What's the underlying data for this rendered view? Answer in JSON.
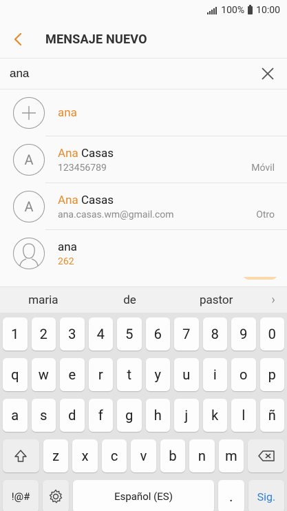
{
  "status": {
    "battery": "100%",
    "time": "10:00"
  },
  "header": {
    "title": "MENSAJE NUEVO"
  },
  "recipient": {
    "value": "ana"
  },
  "suggestions": {
    "add": {
      "label": "ana"
    },
    "items": [
      {
        "initial": "A",
        "name_match": "Ana",
        "name_rest": " Casas",
        "detail": "123456789",
        "type": "Móvil"
      },
      {
        "initial": "A",
        "name_match": "Ana",
        "name_rest": " Casas",
        "detail": "ana.casas.wm@gmail.com",
        "type": "Otro"
      },
      {
        "name": "ana",
        "detail": "262"
      }
    ]
  },
  "predictions": [
    "maria",
    "de",
    "pastor"
  ],
  "keyboard": {
    "row1": [
      "1",
      "2",
      "3",
      "4",
      "5",
      "6",
      "7",
      "8",
      "9",
      "0"
    ],
    "row2": [
      "q",
      "w",
      "e",
      "r",
      "t",
      "y",
      "u",
      "i",
      "o",
      "p"
    ],
    "row3": [
      "a",
      "s",
      "d",
      "f",
      "g",
      "h",
      "j",
      "k",
      "l",
      "ñ"
    ],
    "row4": [
      "z",
      "x",
      "c",
      "v",
      "b",
      "n",
      "m"
    ],
    "symbols_label": "!@#",
    "space_label": "Español (ES)",
    "period_label": ".",
    "enter_label": "Sig."
  },
  "colors": {
    "accent": "#e88a28",
    "enter": "#2f7fd6"
  }
}
